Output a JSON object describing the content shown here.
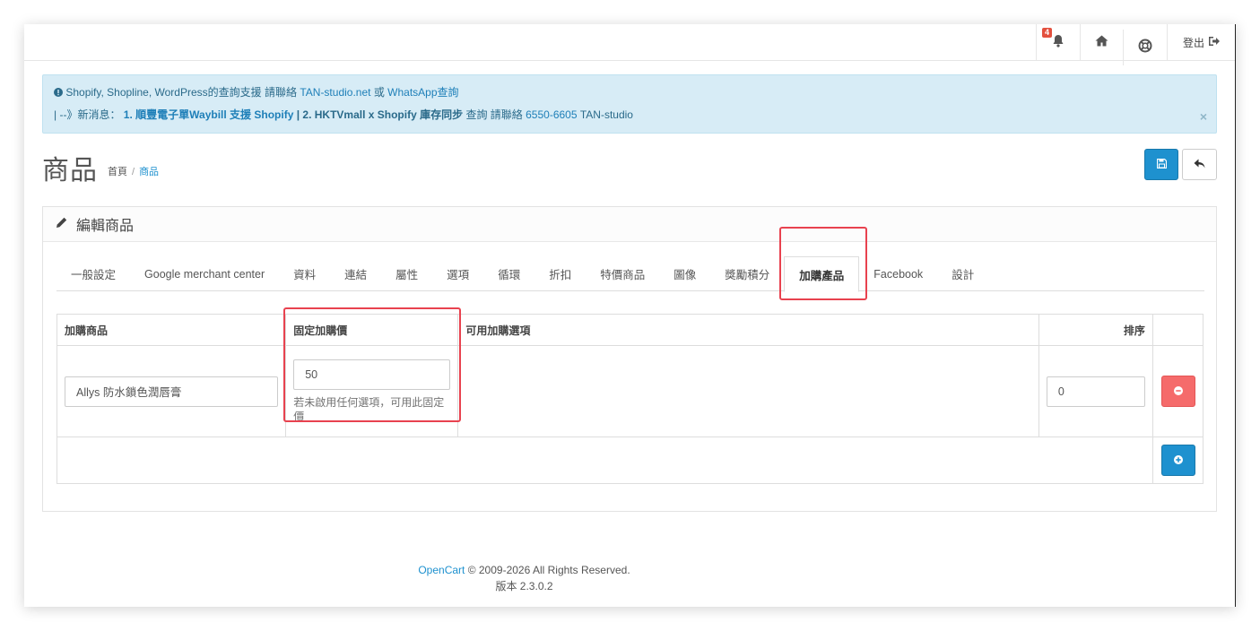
{
  "header": {
    "notification_count": "4",
    "logout_label": "登出"
  },
  "alert": {
    "line1_prefix": "Shopify, Shopline, WordPress的查詢支援 請聯絡 ",
    "line1_link1": "TAN-studio.net",
    "line1_or": " 或 ",
    "line1_link2": "WhatsApp查詢",
    "line2_prefix": "| --》新消息：",
    "line2_item1": "1. 順豐電子單Waybill 支援 Shopify",
    "line2_mid": " | ",
    "line2_item2": "2. HKTVmall x Shopify 庫存同步",
    "line2_query": " 查詢 請聯絡 ",
    "line2_phone": "6550-6605",
    "line2_suffix": " TAN-studio",
    "close": "×"
  },
  "page": {
    "title": "商品",
    "breadcrumb_home": "首頁",
    "breadcrumb_sep": "/",
    "breadcrumb_current": "商品"
  },
  "panel": {
    "title": "編輯商品"
  },
  "tabs": [
    {
      "label": "一般設定"
    },
    {
      "label": "Google merchant center"
    },
    {
      "label": "資料"
    },
    {
      "label": "連結"
    },
    {
      "label": "屬性"
    },
    {
      "label": "選項"
    },
    {
      "label": "循環"
    },
    {
      "label": "折扣"
    },
    {
      "label": "特價商品"
    },
    {
      "label": "圖像"
    },
    {
      "label": "獎勵積分"
    },
    {
      "label": "加購產品"
    },
    {
      "label": "Facebook"
    },
    {
      "label": "設計"
    }
  ],
  "table": {
    "headers": {
      "product": "加購商品",
      "fixed_price": "固定加購價",
      "options": "可用加購選項",
      "sort": "排序"
    },
    "row": {
      "product": "Allys 防水鎖色潤唇膏",
      "fixed_price": "50",
      "fixed_price_help": "若未啟用任何選項，可用此固定價",
      "sort": "0"
    }
  },
  "footer": {
    "link": "OpenCart",
    "copyright": " © 2009-2026 All Rights Reserved.",
    "version": "版本 2.3.0.2"
  },
  "colors": {
    "primary": "#1e91cf",
    "danger": "#f56b6b",
    "highlight": "#e8424f",
    "alert_bg": "#d7ecf6"
  }
}
